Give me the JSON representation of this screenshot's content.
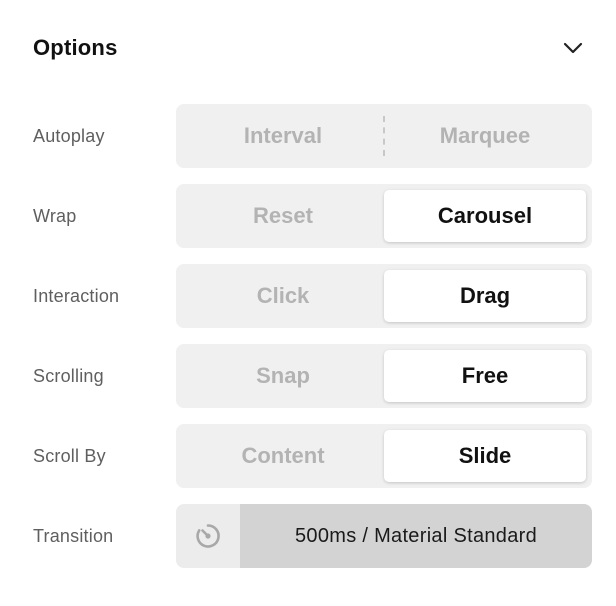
{
  "header": {
    "title": "Options",
    "collapse_icon": "chevron-down-icon"
  },
  "rows": [
    {
      "label": "Autoplay",
      "options": [
        "Interval",
        "Marquee"
      ],
      "selected": null
    },
    {
      "label": "Wrap",
      "options": [
        "Reset",
        "Carousel"
      ],
      "selected": "Carousel"
    },
    {
      "label": "Interaction",
      "options": [
        "Click",
        "Drag"
      ],
      "selected": "Drag"
    },
    {
      "label": "Scrolling",
      "options": [
        "Snap",
        "Free"
      ],
      "selected": "Free"
    },
    {
      "label": "Scroll By",
      "options": [
        "Content",
        "Slide"
      ],
      "selected": "Slide"
    }
  ],
  "transition": {
    "label": "Transition",
    "icon": "timer-icon",
    "value": "500ms / Material Standard"
  },
  "colors": {
    "segment_bg": "#f0f0f0",
    "active_bg": "#ffffff",
    "inactive_text": "#b3b3b3",
    "active_text": "#111111",
    "transition_value_bg": "#d3d3d3"
  }
}
